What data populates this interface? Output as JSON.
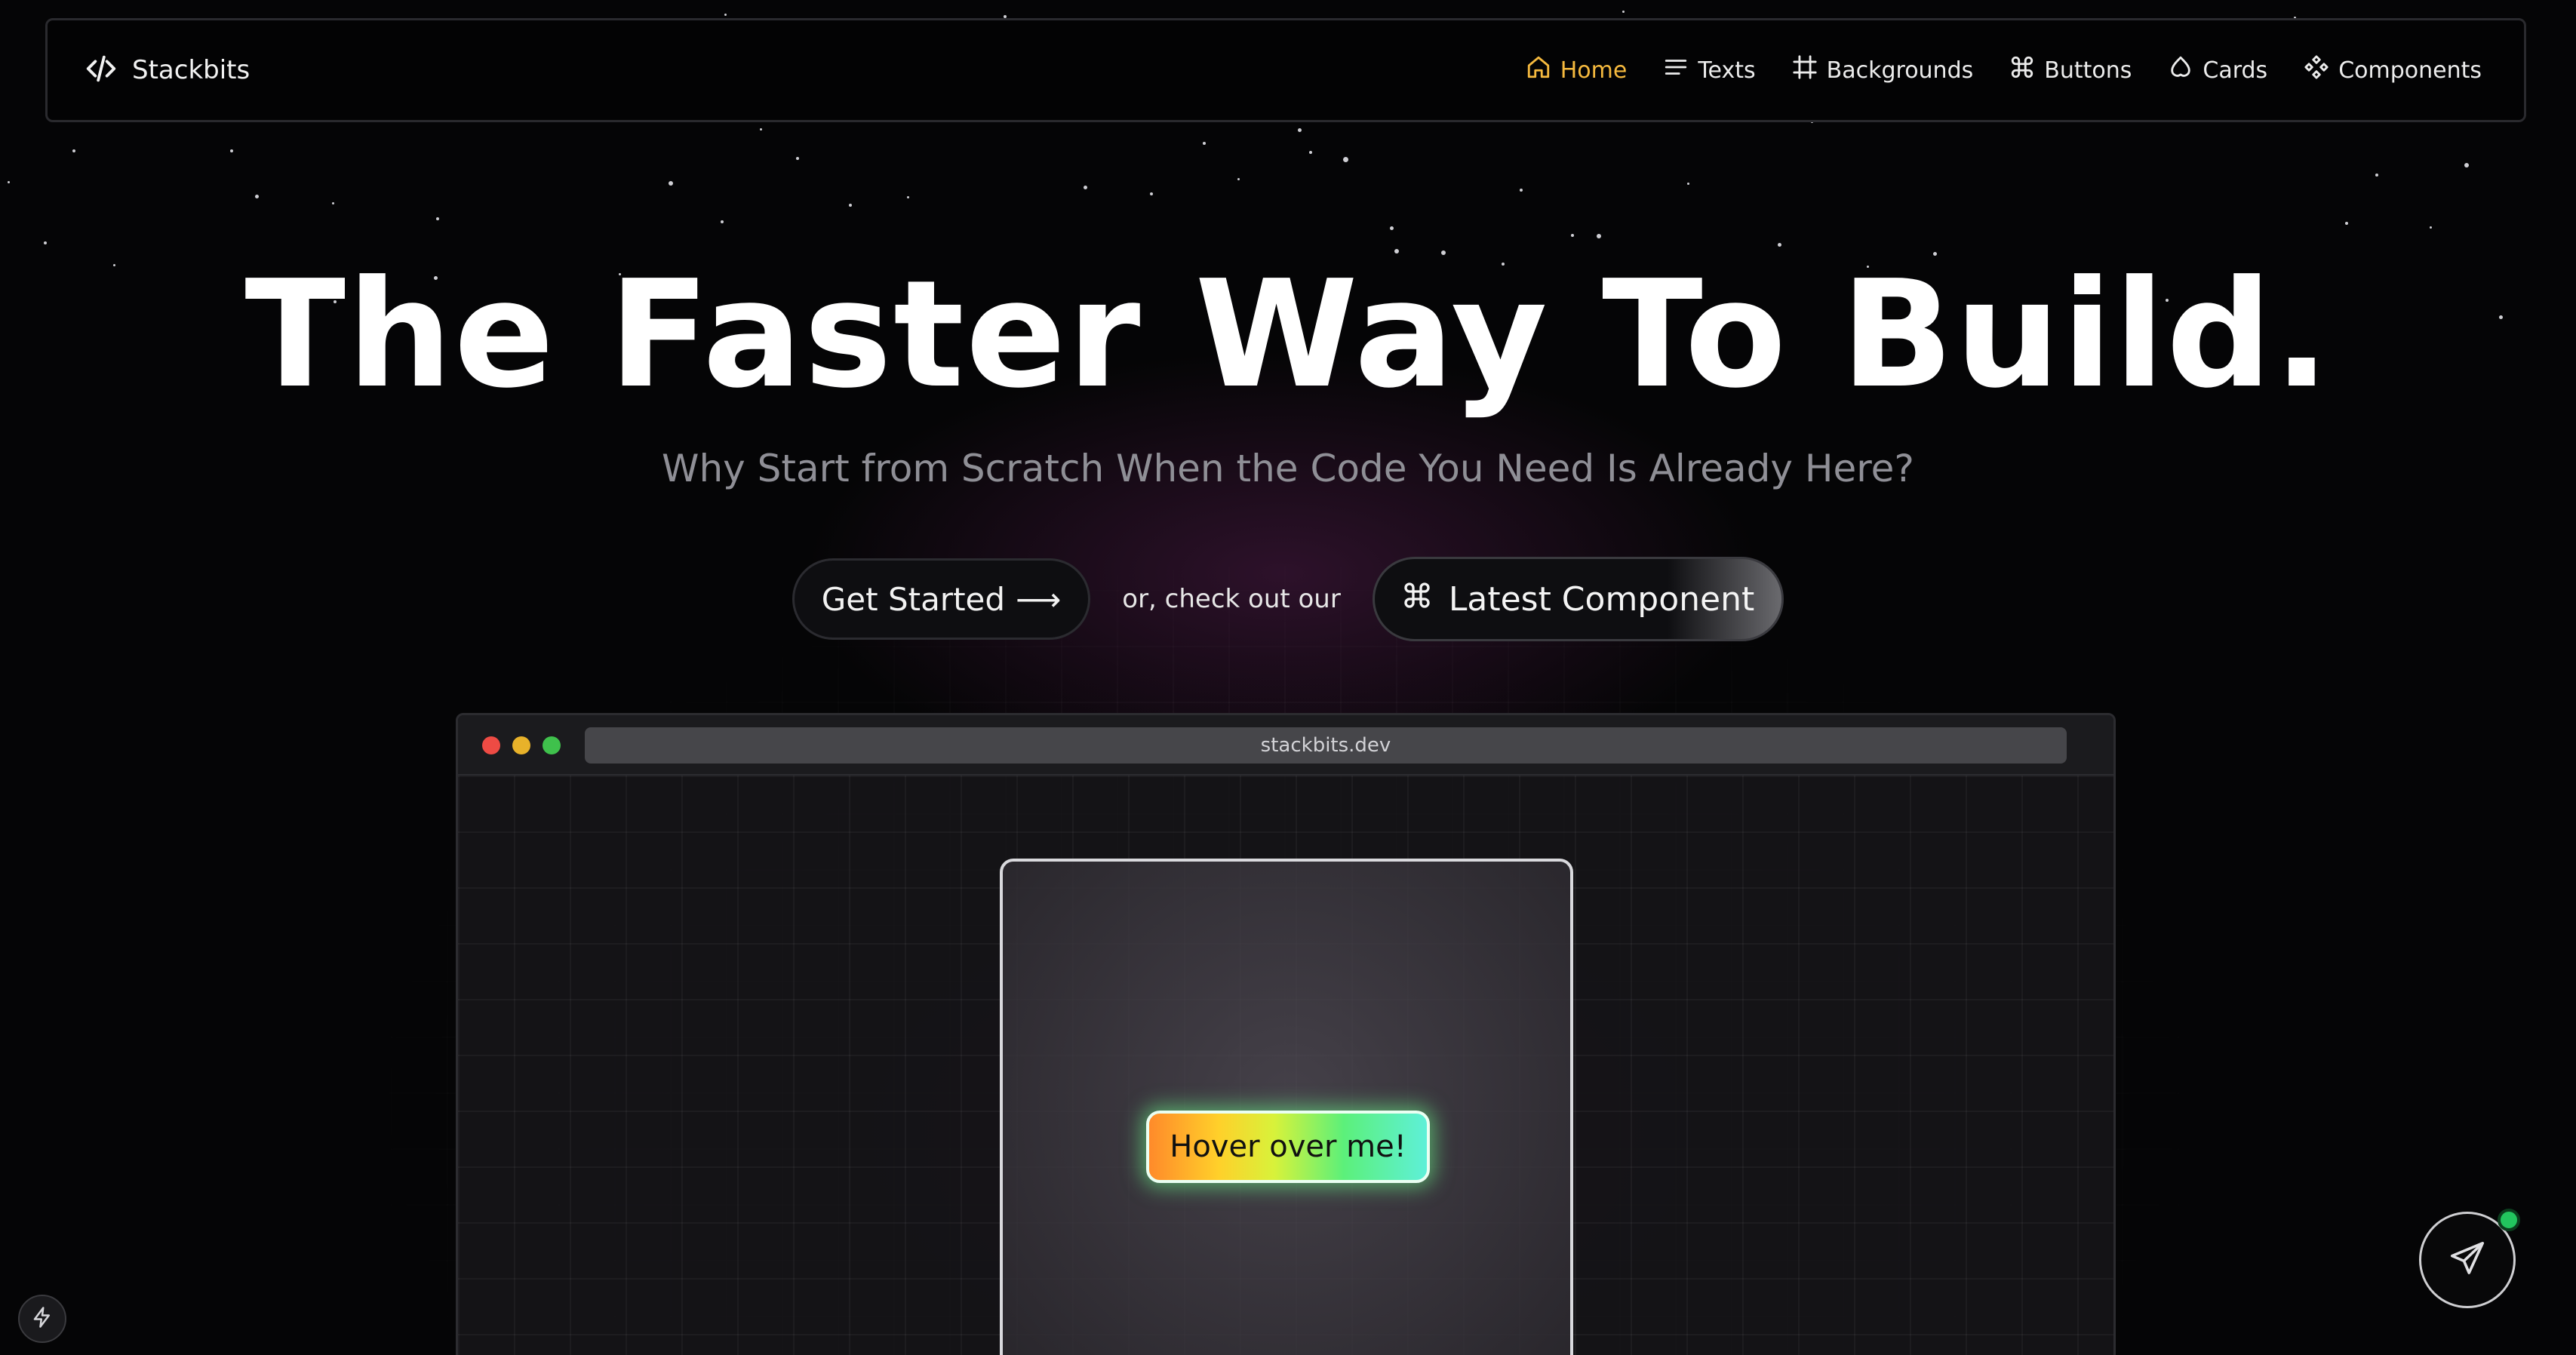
{
  "brand": {
    "name": "Stackbits",
    "icon": "code-icon"
  },
  "nav": {
    "items": [
      {
        "label": "Home",
        "icon": "home-icon",
        "active": true
      },
      {
        "label": "Texts",
        "icon": "text-lines-icon",
        "active": false
      },
      {
        "label": "Backgrounds",
        "icon": "hash-frame-icon",
        "active": false
      },
      {
        "label": "Buttons",
        "icon": "command-icon",
        "active": false
      },
      {
        "label": "Cards",
        "icon": "cloud-icon",
        "active": false
      },
      {
        "label": "Components",
        "icon": "component-icon",
        "active": false
      }
    ]
  },
  "hero": {
    "title": "The Faster Way To Build.",
    "subtitle": "Why Start from Scratch When the Code You Need Is Already Here?",
    "cta_primary": "Get Started",
    "cta_primary_arrow": "⟶",
    "cta_middle_text": "or, check out our",
    "cta_secondary": "Latest Component"
  },
  "browser": {
    "url": "stackbits.dev",
    "demo_button": "Hover over me!"
  },
  "colors": {
    "active_nav": "#f5b93e",
    "background": "#050506",
    "online_indicator": "#22c55e"
  }
}
